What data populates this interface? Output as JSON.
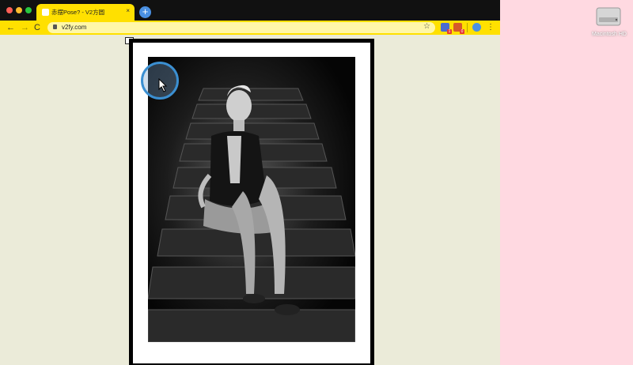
{
  "browser": {
    "tab_title": "赤摆Pose? - V2方圆",
    "tab_close": "×",
    "new_tab": "+",
    "url": "v2fy.com",
    "nav": {
      "back": "←",
      "forward": "→",
      "reload": "C"
    },
    "star": "☆",
    "menu": "⋮",
    "extensions": [
      {
        "name": "extension-1",
        "badge": "1"
      },
      {
        "name": "extension-2",
        "badge": "0"
      },
      {
        "name": "extension-music"
      }
    ],
    "accent_color": "#ffe000"
  },
  "desktop": {
    "background_color": "#ffd9e1",
    "drive_label": "Macintosh HD"
  },
  "page": {
    "background_color": "#ebebd9",
    "image_alt": "Black and white photo of a woman sitting on stairs"
  }
}
